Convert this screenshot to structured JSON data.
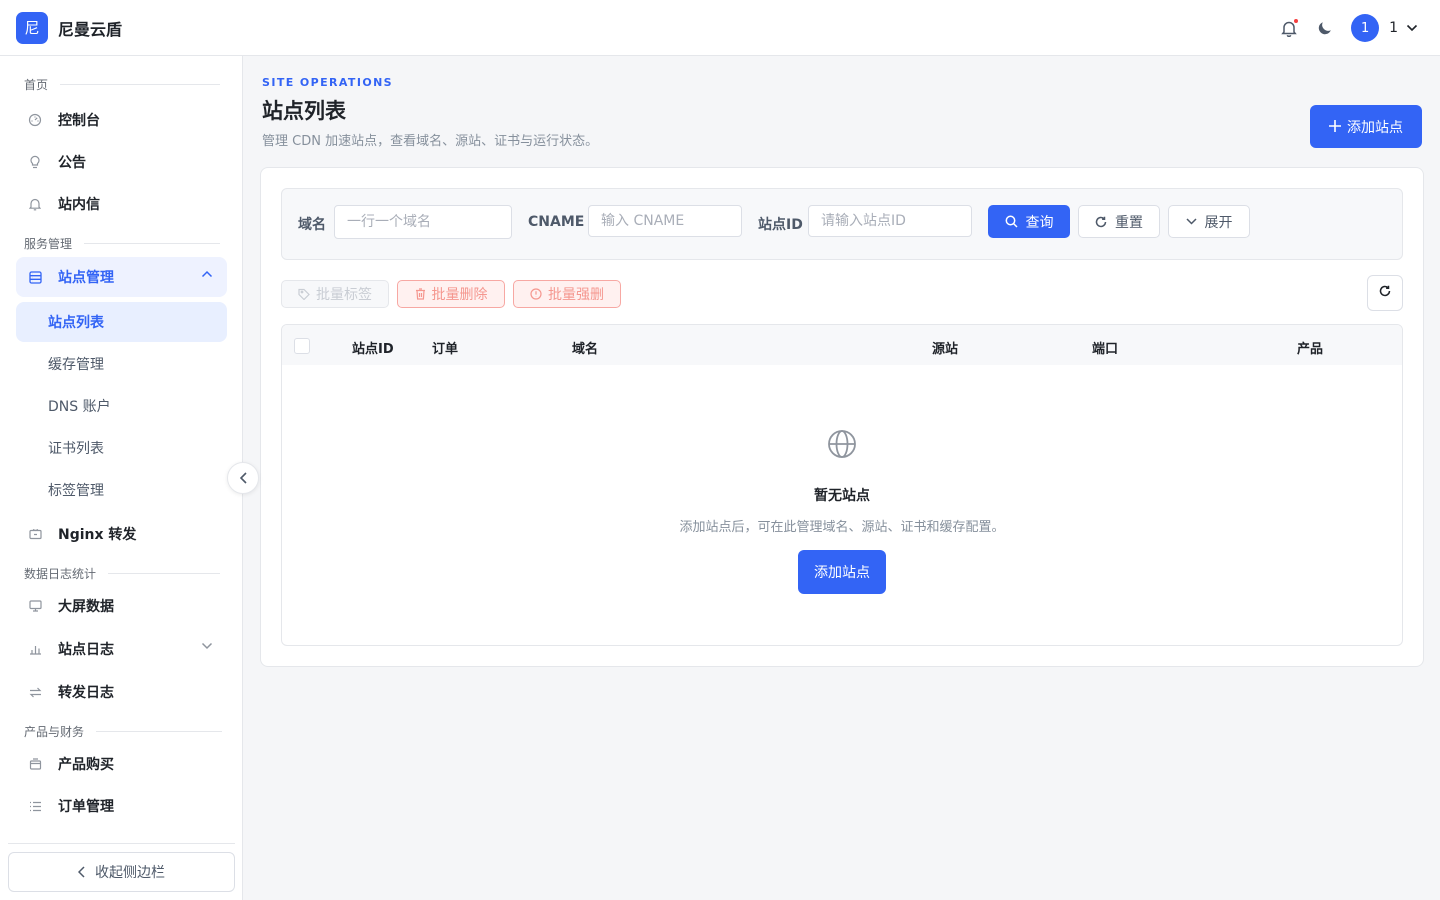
{
  "app": {
    "logo_char": "尼",
    "brand": "尼曼云盾"
  },
  "header": {
    "user_avatar": "1",
    "user_name": "1"
  },
  "sidebar": {
    "sections": [
      "首页",
      "服务管理",
      "数据日志统计",
      "产品与财务"
    ],
    "items": [
      {
        "label": "控制台",
        "icon": "dashboard-icon"
      },
      {
        "label": "公告",
        "icon": "bulb-icon"
      },
      {
        "label": "站内信",
        "icon": "bell-icon"
      },
      {
        "label": "站点管理",
        "icon": "server-icon"
      },
      {
        "label": "Nginx 转发",
        "icon": "forward-icon"
      },
      {
        "label": "大屏数据",
        "icon": "monitor-icon"
      },
      {
        "label": "站点日志",
        "icon": "bar-chart-icon"
      },
      {
        "label": "转发日志",
        "icon": "swap-icon"
      },
      {
        "label": "产品购买",
        "icon": "shop-icon"
      },
      {
        "label": "订单管理",
        "icon": "list-icon"
      }
    ],
    "sub_items": [
      "站点列表",
      "缓存管理",
      "DNS 账户",
      "证书列表",
      "标签管理"
    ],
    "collapse_label": "收起侧边栏"
  },
  "page": {
    "eyebrow": "SITE OPERATIONS",
    "title": "站点列表",
    "description": "管理 CDN 加速站点，查看域名、源站、证书与运行状态。",
    "add_button": "添加站点"
  },
  "filter": {
    "domain_label": "域名",
    "domain_placeholder": "一行一个域名",
    "cname_label": "CNAME",
    "cname_placeholder": "输入 CNAME",
    "siteid_label": "站点ID",
    "siteid_placeholder": "请输入站点ID",
    "query": "查询",
    "reset": "重置",
    "expand": "展开"
  },
  "batch": {
    "tag": "批量标签",
    "delete": "批量删除",
    "force_delete": "批量强删"
  },
  "table": {
    "columns": [
      "站点ID",
      "订单",
      "域名",
      "源站",
      "端口",
      "产品"
    ],
    "empty_title": "暂无站点",
    "empty_desc": "添加站点后，可在此管理域名、源站、证书和缓存配置。",
    "empty_button": "添加站点"
  },
  "colors": {
    "primary": "#3364f5",
    "danger": "#f53f3f"
  }
}
